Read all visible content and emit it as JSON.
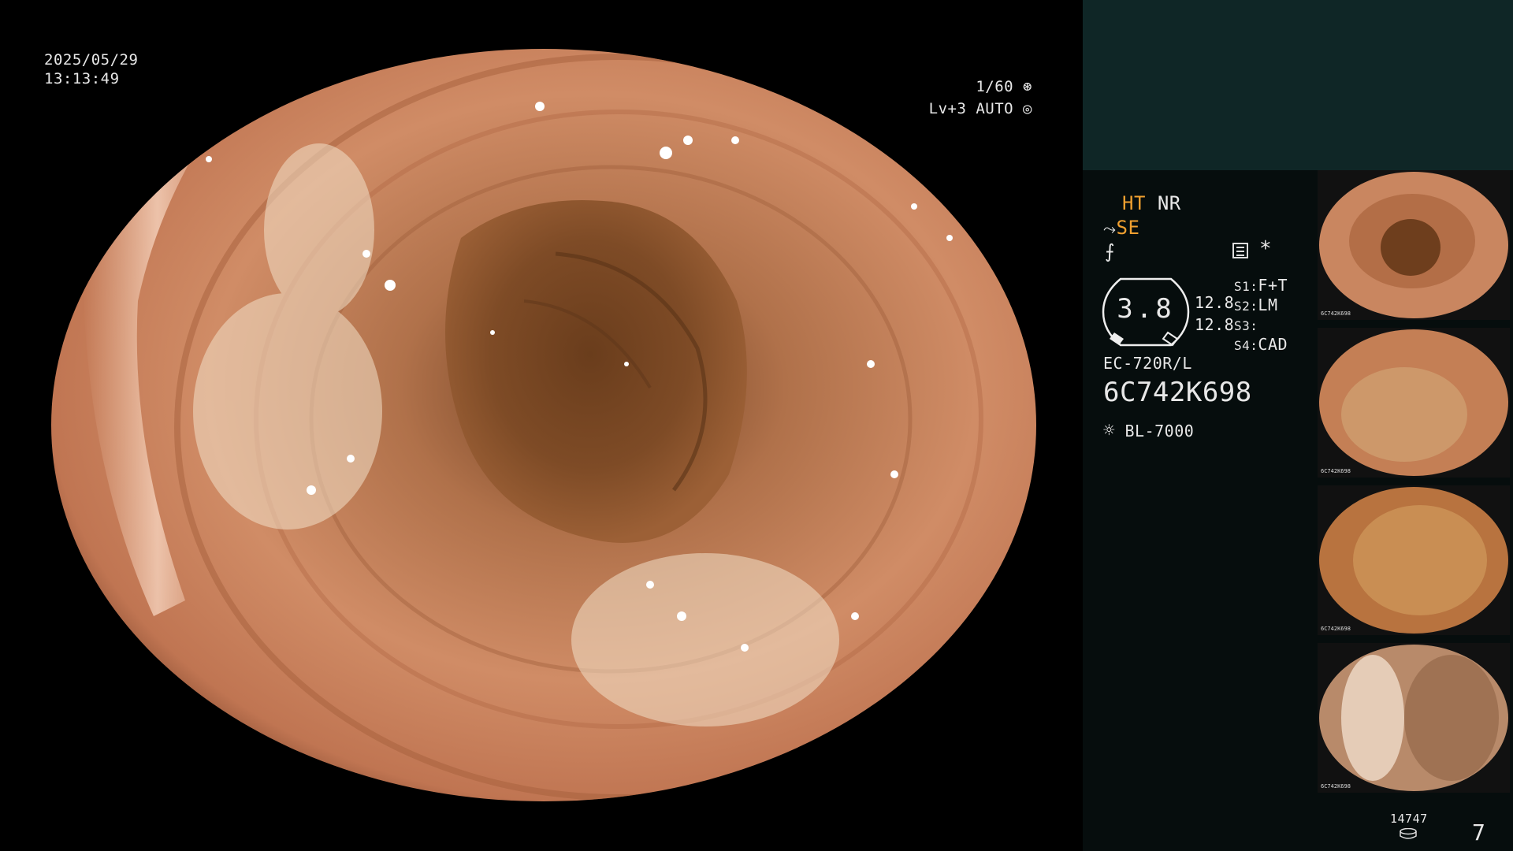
{
  "overlay": {
    "date": "2025/05/29",
    "time": "13:13:49",
    "shutter": "1/60",
    "level_mode": "Lv+3 AUTO"
  },
  "panel": {
    "ht": "HT",
    "nr": "NR",
    "se": "SE",
    "zoom_value": "3.8",
    "zoom_a": "12.8",
    "zoom_b": "12.8",
    "s1": "S1:",
    "s1_val": "F+T",
    "s2": "S2:",
    "s2_val": "LM",
    "s3": "S3:",
    "s4": "S4:",
    "s4_val": "CAD",
    "scope_model": "EC-720R/L",
    "serial": "6C742K698",
    "light_source": "BL-7000",
    "storage_count": "14747",
    "image_count": "7",
    "star": "*"
  },
  "thumbnails": [
    {
      "label": "6C742K698"
    },
    {
      "label": "6C742K698"
    },
    {
      "label": "6C742K698"
    },
    {
      "label": "6C742K698"
    }
  ],
  "colors": {
    "accent_orange": "#f0a030",
    "panel_top": "#0f2626",
    "panel": "#060d0d"
  }
}
